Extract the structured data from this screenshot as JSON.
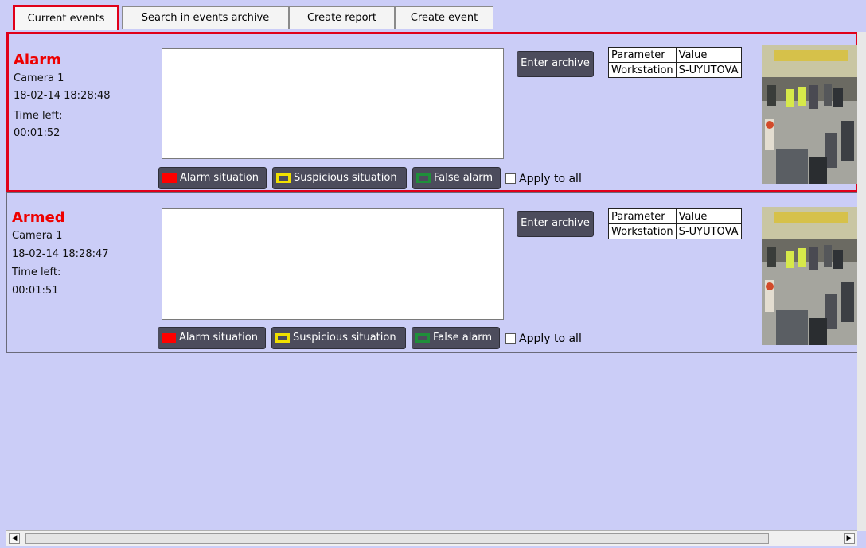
{
  "tabs": [
    {
      "label": "Current events",
      "active": true
    },
    {
      "label": "Search in events archive",
      "active": false
    },
    {
      "label": "Create report",
      "active": false
    },
    {
      "label": "Create event",
      "active": false
    }
  ],
  "events": [
    {
      "title": "Alarm",
      "camera": "Camera 1",
      "datetime": "18-02-14 18:28:48",
      "time_left_label": "Time left:",
      "time_left": "00:01:52",
      "note_text": "",
      "archive_button": "Enter archive",
      "params": {
        "header": [
          "Parameter",
          "Value"
        ],
        "rows": [
          [
            "Workstation",
            "S-UYUTOVA"
          ]
        ]
      },
      "actions": {
        "alarm": "Alarm situation",
        "suspicious": "Suspicious situation",
        "false_alarm": "False alarm",
        "apply_all": "Apply to all"
      }
    },
    {
      "title": "Armed",
      "camera": "Camera 1",
      "datetime": "18-02-14 18:28:47",
      "time_left_label": "Time left:",
      "time_left": "00:01:51",
      "note_text": "",
      "archive_button": "Enter archive",
      "params": {
        "header": [
          "Parameter",
          "Value"
        ],
        "rows": [
          [
            "Workstation",
            "S-UYUTOVA"
          ]
        ]
      },
      "actions": {
        "alarm": "Alarm situation",
        "suspicious": "Suspicious situation",
        "false_alarm": "False alarm",
        "apply_all": "Apply to all"
      }
    }
  ],
  "colors": {
    "alarm": "#ff0000",
    "suspicious": "#f0e000",
    "false_alarm": "#1f8f3a",
    "selection_border": "#e0001a",
    "background": "#cbcdf7"
  },
  "icons": {
    "scroll_left": "◀",
    "scroll_right": "▶"
  }
}
